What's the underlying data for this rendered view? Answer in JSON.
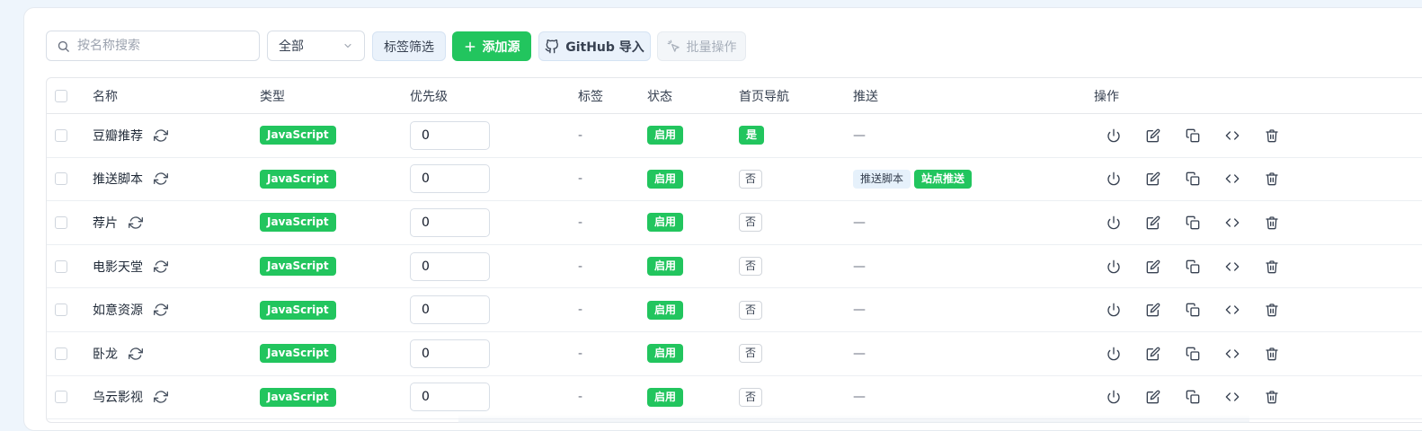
{
  "toolbar": {
    "search_placeholder": "按名称搜索",
    "filter_select_value": "全部",
    "tag_filter_label": "标签筛选",
    "add_source_label": "添加源",
    "github_import_label": "GitHub 导入",
    "batch_label": "批量操作"
  },
  "table": {
    "headers": {
      "name": "名称",
      "type": "类型",
      "priority": "优先级",
      "tags": "标签",
      "status": "状态",
      "home_nav": "首页导航",
      "push": "推送",
      "actions": "操作"
    },
    "rows": [
      {
        "name": "豆瓣推荐",
        "type": "JavaScript",
        "priority": "0",
        "tags": "-",
        "status": "启用",
        "home_nav": "是",
        "push": "—"
      },
      {
        "name": "推送脚本",
        "type": "JavaScript",
        "priority": "0",
        "tags": "-",
        "status": "启用",
        "home_nav": "否",
        "push_tags": [
          "推送脚本",
          "站点推送"
        ]
      },
      {
        "name": "荐片",
        "type": "JavaScript",
        "priority": "0",
        "tags": "-",
        "status": "启用",
        "home_nav": "否",
        "push": "—"
      },
      {
        "name": "电影天堂",
        "type": "JavaScript",
        "priority": "0",
        "tags": "-",
        "status": "启用",
        "home_nav": "否",
        "push": "—"
      },
      {
        "name": "如意资源",
        "type": "JavaScript",
        "priority": "0",
        "tags": "-",
        "status": "启用",
        "home_nav": "否",
        "push": "—"
      },
      {
        "name": "卧龙",
        "type": "JavaScript",
        "priority": "0",
        "tags": "-",
        "status": "启用",
        "home_nav": "否",
        "push": "—"
      },
      {
        "name": "乌云影视",
        "type": "JavaScript",
        "priority": "0",
        "tags": "-",
        "status": "启用",
        "home_nav": "否",
        "push": "—"
      }
    ]
  },
  "icons": {
    "search": "search-icon",
    "chevron": "chevron-down-icon",
    "plus": "plus-icon",
    "github": "github-icon",
    "batch": "pointer-click-icon",
    "refresh": "refresh-icon",
    "power": "power-icon",
    "edit": "edit-icon",
    "copy": "copy-icon",
    "code": "code-icon",
    "trash": "trash-icon"
  },
  "colors": {
    "accent_green": "#22c55e",
    "light_blue": "#eaf2fb"
  }
}
